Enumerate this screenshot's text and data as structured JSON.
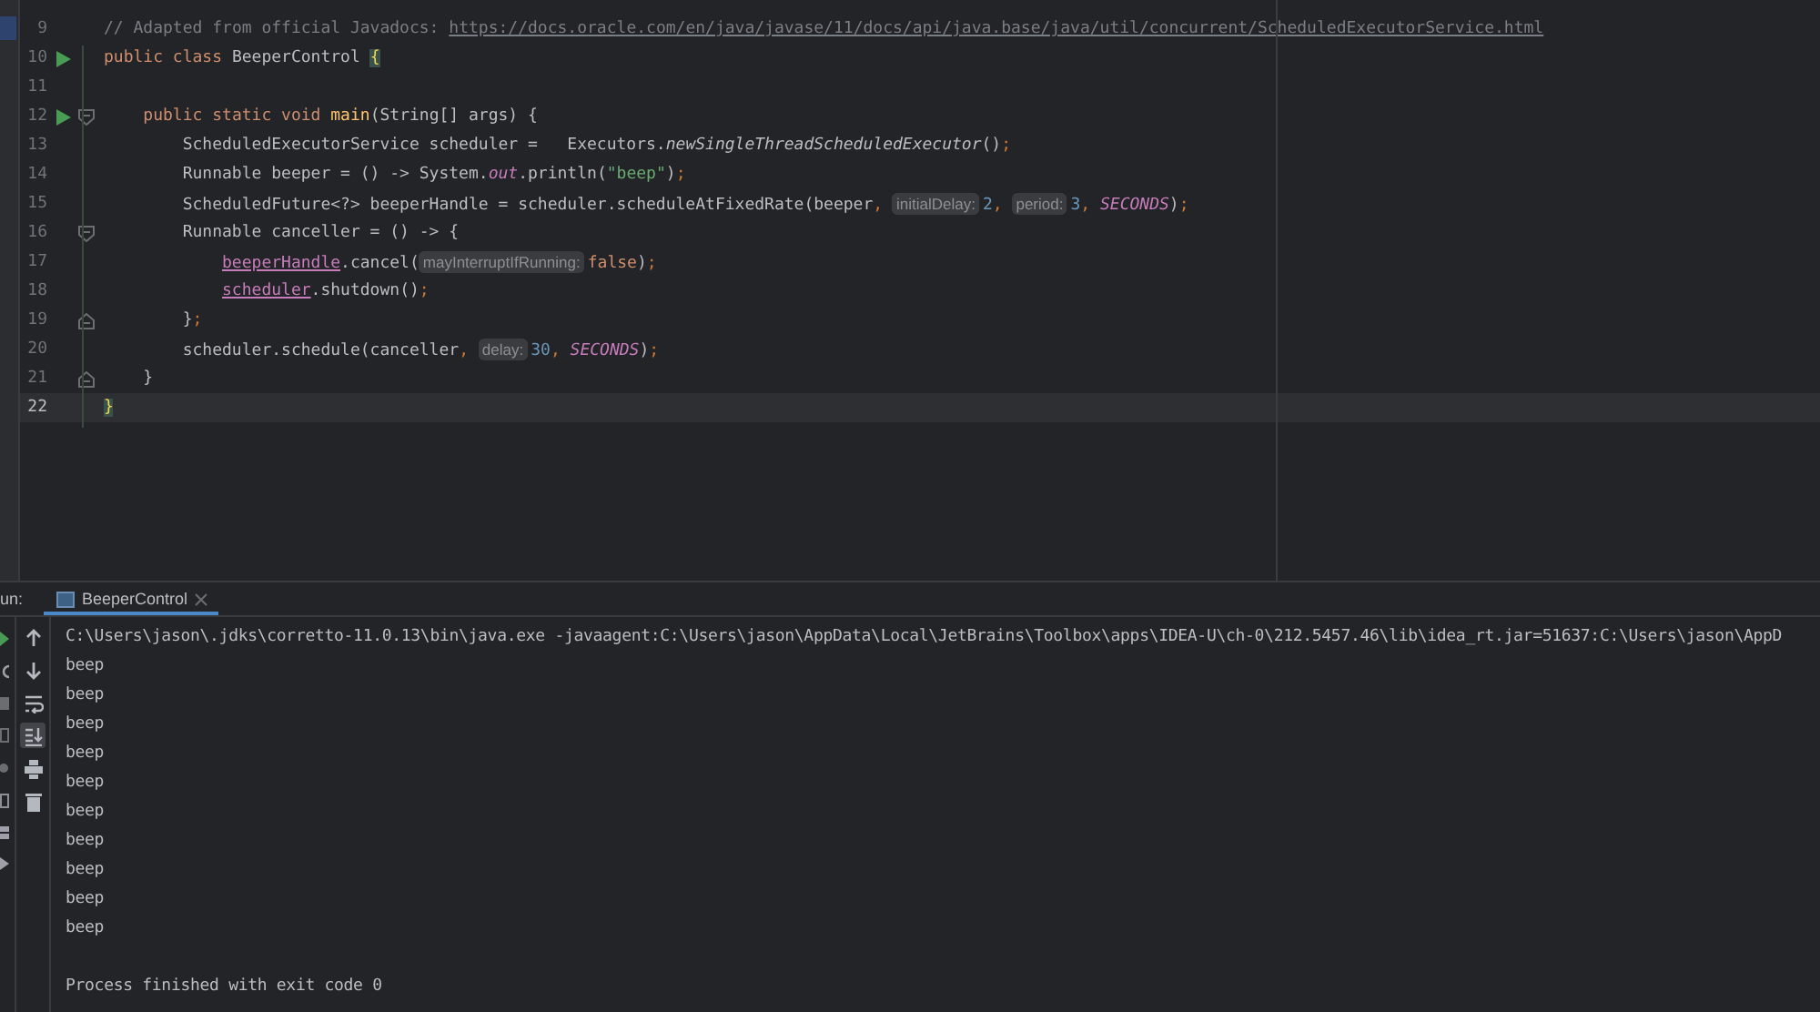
{
  "editor": {
    "lines": [
      {
        "number": "9",
        "tokens": [
          {
            "kind": "comment",
            "text": "// Adapted from official Javadocs: "
          },
          {
            "kind": "link",
            "text": "https://docs.oracle.com/en/java/javase/11/docs/api/java.base/java/util/concurrent/ScheduledExecutorService.html"
          }
        ]
      },
      {
        "number": "10",
        "run": true,
        "tokens": [
          {
            "kind": "keyword",
            "text": "public class "
          },
          {
            "kind": "plain",
            "text": "BeeperControl "
          },
          {
            "kind": "brace",
            "text": "{"
          }
        ],
        "children": [
          {
            "number": "11"
          },
          {
            "number": "12",
            "run": true,
            "fold_start": true,
            "tokens": [
              {
                "kind": "keyword",
                "text": "public static void "
              },
              {
                "kind": "method",
                "text": "main"
              },
              {
                "kind": "plain",
                "text": "(String[] args) {"
              }
            ],
            "children": [
              {
                "number": "13",
                "tokens": [
                  {
                    "kind": "plain",
                    "text": "ScheduledExecutorService scheduler =   Executors."
                  },
                  {
                    "kind": "static",
                    "text": "newSingleThreadScheduledExecutor"
                  },
                  {
                    "kind": "plain",
                    "text": "()"
                  },
                  {
                    "kind": "punct",
                    "text": ";"
                  }
                ]
              },
              {
                "number": "14",
                "tokens": [
                  {
                    "kind": "plain",
                    "text": "Runnable beeper = () -> System."
                  },
                  {
                    "kind": "constant",
                    "text": "out"
                  },
                  {
                    "kind": "plain",
                    "text": ".println("
                  },
                  {
                    "kind": "string",
                    "text": "\"beep\""
                  },
                  {
                    "kind": "plain",
                    "text": ")"
                  },
                  {
                    "kind": "punct",
                    "text": ";"
                  }
                ]
              },
              {
                "number": "15",
                "tokens": [
                  {
                    "kind": "plain",
                    "text": "ScheduledFuture<?> beeperHandle = scheduler.scheduleAtFixedRate(beeper"
                  },
                  {
                    "kind": "punct",
                    "text": ", "
                  },
                  {
                    "kind": "hint",
                    "text": "initialDelay:"
                  },
                  {
                    "kind": "number",
                    "text": "2"
                  },
                  {
                    "kind": "punct",
                    "text": ", "
                  },
                  {
                    "kind": "hint",
                    "text": "period:"
                  },
                  {
                    "kind": "number",
                    "text": "3"
                  },
                  {
                    "kind": "punct",
                    "text": ", "
                  },
                  {
                    "kind": "constant",
                    "text": "SECONDS"
                  },
                  {
                    "kind": "plain",
                    "text": ")"
                  },
                  {
                    "kind": "punct",
                    "text": ";"
                  }
                ]
              },
              {
                "number": "16",
                "fold_start": true,
                "tokens": [
                  {
                    "kind": "plain",
                    "text": "Runnable canceller = () -> {"
                  }
                ],
                "children": [
                  {
                    "number": "17",
                    "tokens": [
                      {
                        "kind": "captured",
                        "text": "beeperHandle"
                      },
                      {
                        "kind": "plain",
                        "text": ".cancel("
                      },
                      {
                        "kind": "hint",
                        "text": "mayInterruptIfRunning:"
                      },
                      {
                        "kind": "keyword",
                        "text": "false"
                      },
                      {
                        "kind": "plain",
                        "text": ")"
                      },
                      {
                        "kind": "punct",
                        "text": ";"
                      }
                    ]
                  },
                  {
                    "number": "18",
                    "tokens": [
                      {
                        "kind": "captured",
                        "text": "scheduler"
                      },
                      {
                        "kind": "plain",
                        "text": ".shutdown()"
                      },
                      {
                        "kind": "punct",
                        "text": ";"
                      }
                    ]
                  }
                ]
              },
              {
                "number": "19",
                "fold_end": true,
                "tokens": [
                  {
                    "kind": "plain",
                    "text": "}"
                  },
                  {
                    "kind": "punct",
                    "text": ";"
                  }
                ]
              },
              {
                "number": "20",
                "tokens": [
                  {
                    "kind": "plain",
                    "text": "scheduler.schedule(canceller"
                  },
                  {
                    "kind": "punct",
                    "text": ", "
                  },
                  {
                    "kind": "hint",
                    "text": "delay:"
                  },
                  {
                    "kind": "number",
                    "text": "30"
                  },
                  {
                    "kind": "punct",
                    "text": ", "
                  },
                  {
                    "kind": "constant",
                    "text": "SECONDS"
                  },
                  {
                    "kind": "plain",
                    "text": ")"
                  },
                  {
                    "kind": "punct",
                    "text": ";"
                  }
                ]
              }
            ]
          },
          {
            "number": "21",
            "fold_end": true,
            "tokens": [
              {
                "kind": "plain",
                "text": "}"
              }
            ]
          }
        ]
      },
      {
        "number": "22",
        "current": true,
        "tokens": [
          {
            "kind": "brace",
            "text": "}"
          }
        ]
      }
    ]
  },
  "run_panel": {
    "label": "un:",
    "tabs": [
      {
        "label": "BeeperControl",
        "selected": true
      }
    ],
    "toolbar": [
      {
        "kind": "up",
        "selected": false
      },
      {
        "kind": "down",
        "selected": false
      },
      {
        "kind": "wrap",
        "selected": false
      },
      {
        "kind": "scroll",
        "selected": true
      },
      {
        "kind": "print",
        "selected": false
      },
      {
        "kind": "trash",
        "selected": false
      }
    ],
    "console": {
      "output": [
        "C:\\Users\\jason\\.jdks\\corretto-11.0.13\\bin\\java.exe -javaagent:C:\\Users\\jason\\AppData\\Local\\JetBrains\\Toolbox\\apps\\IDEA-U\\ch-0\\212.5457.46\\lib\\idea_rt.jar=51637:C:\\Users\\jason\\AppD",
        "beep",
        "beep",
        "beep",
        "beep",
        "beep",
        "beep",
        "beep",
        "beep",
        "beep",
        "beep"
      ],
      "exit_message": "Process finished with exit code 0"
    }
  }
}
